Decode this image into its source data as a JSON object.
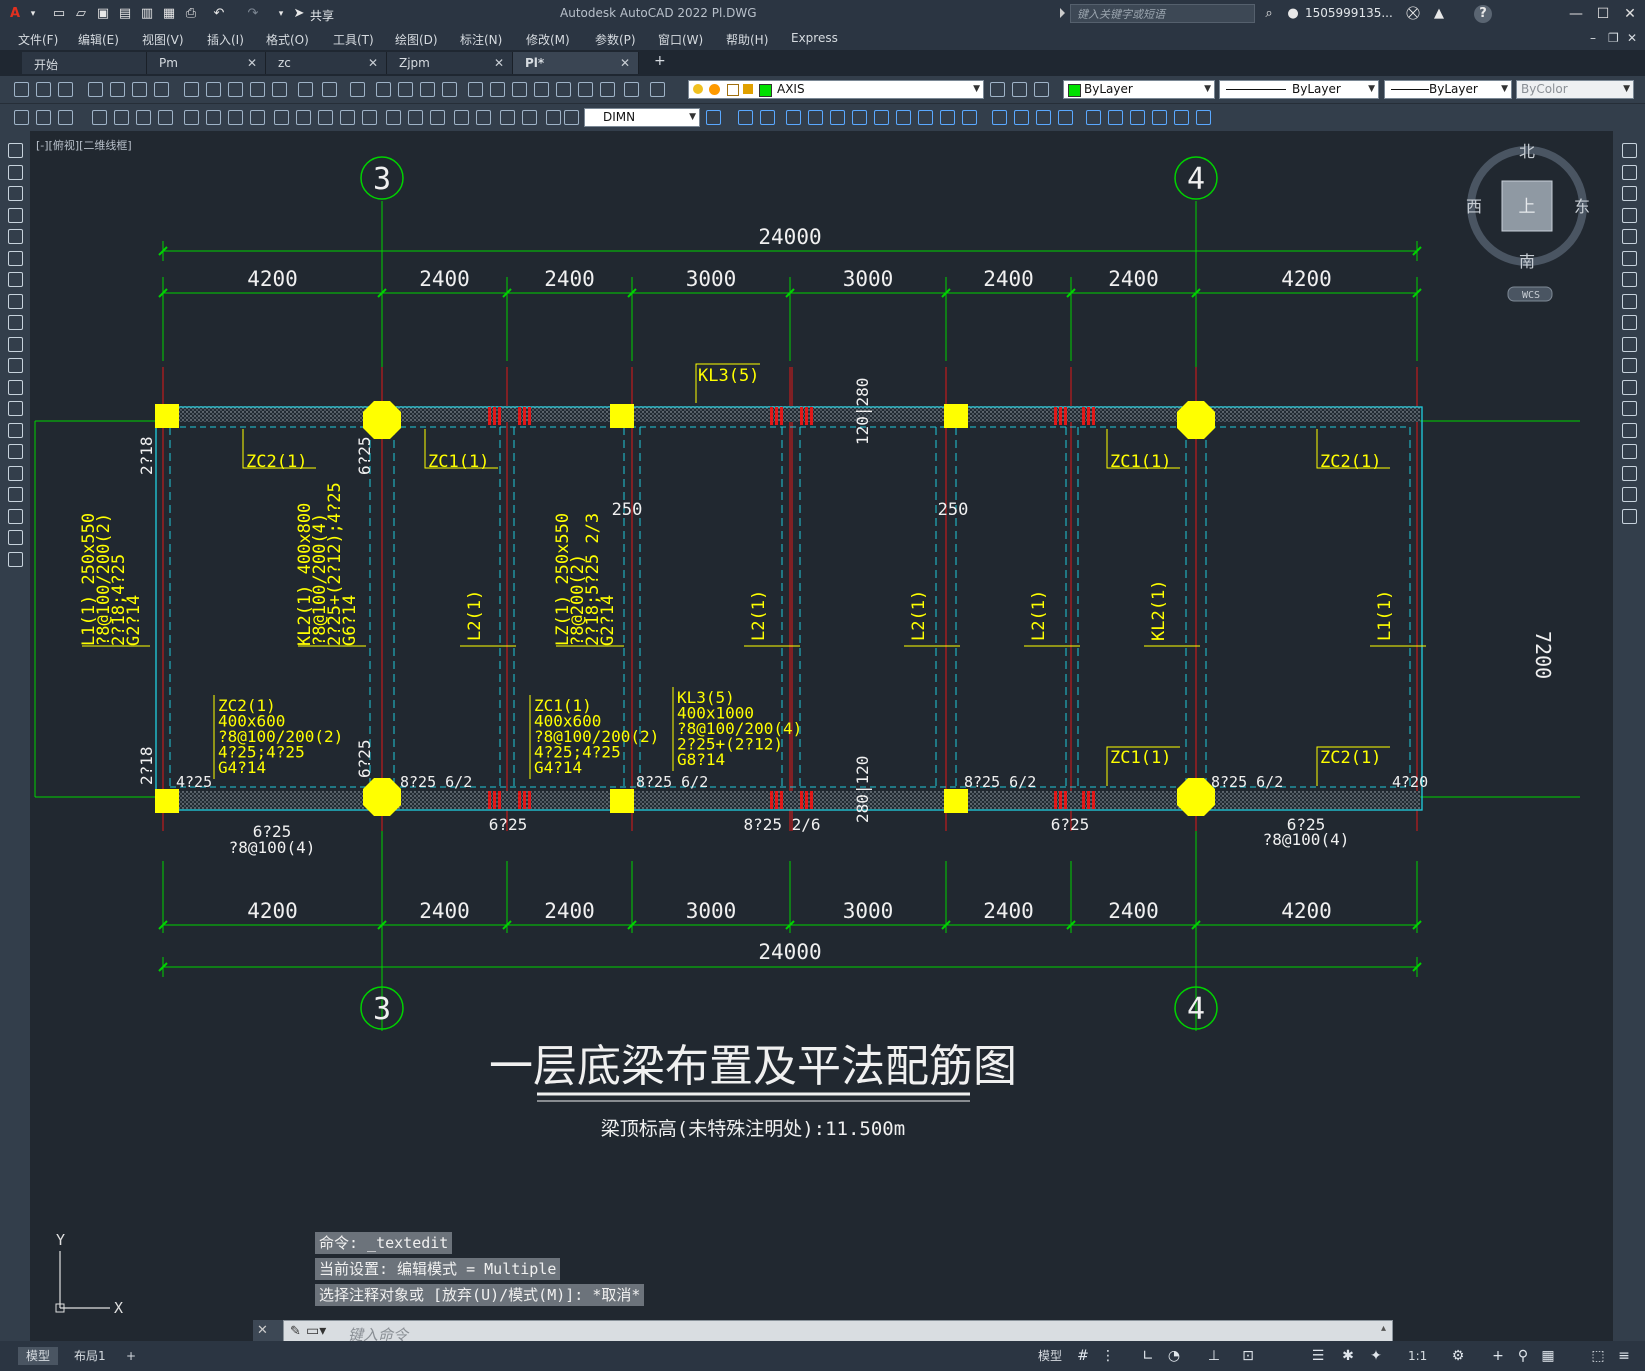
{
  "app": {
    "logo": "A",
    "title": "Autodesk AutoCAD 2022   Pl.DWG",
    "share_label": "共享",
    "search_placeholder": "键入关键字或短语",
    "user": "1505999135...",
    "help": "?"
  },
  "menu": [
    "文件(F)",
    "编辑(E)",
    "视图(V)",
    "插入(I)",
    "格式(O)",
    "工具(T)",
    "绘图(D)",
    "标注(N)",
    "修改(M)",
    "参数(P)",
    "窗口(W)",
    "帮助(H)",
    "Express"
  ],
  "tabs": [
    {
      "label": "开始",
      "close": ""
    },
    {
      "label": "Pm",
      "close": "✕"
    },
    {
      "label": "zc",
      "close": "✕"
    },
    {
      "label": "Zjpm",
      "close": "✕"
    },
    {
      "label": "Pl*",
      "close": "✕"
    },
    {
      "label": "+",
      "close": ""
    }
  ],
  "toolbar": {
    "layer": "AXIS",
    "color": "ByLayer",
    "linetype": "ByLayer",
    "lineweight": "ByLayer",
    "plotstyle": "ByColor",
    "dimstyle": "DIMN"
  },
  "viewport_label": "[-][俯视][二维线框]",
  "viewcube": {
    "north": "北",
    "south": "南",
    "east": "东",
    "west": "西",
    "top": "上",
    "wcs": "WCS"
  },
  "drawing": {
    "axes": {
      "left_top": "3",
      "right_top": "4",
      "left_bottom": "3",
      "right_bottom": "4"
    },
    "dims_top_total": "24000",
    "dims_top": [
      "4200",
      "2400",
      "2400",
      "3000",
      "3000",
      "2400",
      "2400",
      "4200"
    ],
    "dims_bottom": [
      "4200",
      "2400",
      "2400",
      "3000",
      "3000",
      "2400",
      "2400",
      "4200"
    ],
    "dims_bottom_total": "24000",
    "kl3_top": "KL3(5)",
    "dim_120_280": "120|280",
    "dim_280_120": "280|120",
    "dim_250a": "250",
    "dim_250b": "250",
    "side_7200": "7200",
    "labels_top": [
      "ZC2(1)",
      "ZC1(1)",
      "ZC1(1)",
      "ZC2(1)"
    ],
    "labels_bot": [
      "ZC1(1)",
      "ZC2(1)"
    ],
    "left_218_top": "2?18",
    "left_218_bot": "2?18",
    "v625_top": "6?25",
    "v625_bot": "6?25",
    "l1_left": [
      "L1(1) 250x550",
      "?8@100/200(2)",
      "2?18;4?25",
      "G2?14"
    ],
    "kl2_left": [
      "KL2(1) 400x800",
      "?8@100/200(4)",
      "2?25+(2?12);4?25",
      "G6?14"
    ],
    "lz1_mid": [
      "LZ(1) 250x550",
      "?8@200(2)",
      "2?18;5?25 2/3",
      "G2?14"
    ],
    "l2a": "L2(1)",
    "l2b": "L2(1)",
    "l2c": "L2(1)",
    "l2d": "L2(1)",
    "kl2_right": "KL2(1)",
    "l1_right": "L1(1)",
    "zc2_block": [
      "ZC2(1)",
      "400x600",
      "?8@100/200(2)",
      "4?25;4?25",
      "G4?14"
    ],
    "zc1_block": [
      "ZC1(1)",
      "400x600",
      "?8@100/200(2)",
      "4?25;4?25",
      "G4?14"
    ],
    "kl3_block": [
      "KL3(5)",
      "400x1000",
      "?8@100/200(4)",
      "2?25+(2?12)",
      "G8?14"
    ],
    "bot_notes": [
      "4?25",
      "8?25 6/2",
      "8?25 6/2",
      "8?25 6/2",
      "8?25 6/2",
      "4?20"
    ],
    "under_notes": [
      "6?25",
      "?8@100(4)",
      "6?25",
      "8?25 2/6",
      "6?25",
      "6?25",
      "?8@100(4)"
    ],
    "title": "一层底梁布置及平法配筋图",
    "subtitle": "梁顶标高(未特殊注明处):11.500m"
  },
  "ucs": {
    "y": "Y",
    "x": "X"
  },
  "command": {
    "history": [
      "命令: _textedit",
      "当前设置: 编辑模式 = Multiple",
      "选择注释对象或 [放弃(U)/模式(M)]: *取消*"
    ],
    "placeholder": "键入命令"
  },
  "status": {
    "layout_tabs": [
      "模型",
      "布局1",
      "+"
    ],
    "model_label": "模型",
    "scale": "1:1"
  },
  "colors": {
    "green": "#00d200",
    "yellow": "#ffff00",
    "cyan": "#20c8d8",
    "red": "#e01818",
    "white": "#f0f0f0"
  }
}
